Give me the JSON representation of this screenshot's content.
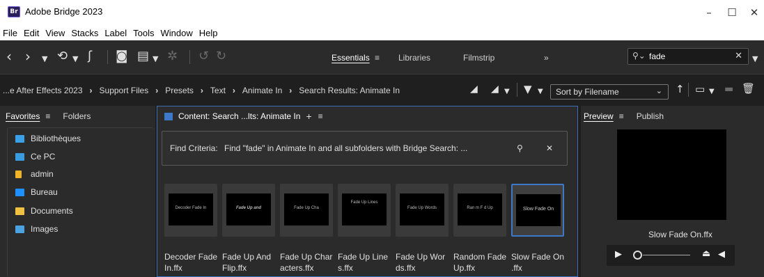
{
  "app": {
    "logo": "Br",
    "title": "Adobe Bridge 2023"
  },
  "window_controls": {
    "minimize": "–",
    "maximize": "☐",
    "close": "✕"
  },
  "menu": [
    "File",
    "Edit",
    "View",
    "Stacks",
    "Label",
    "Tools",
    "Window",
    "Help"
  ],
  "workspace": {
    "tabs": [
      "Essentials",
      "Libraries",
      "Filmstrip"
    ],
    "active": "Essentials",
    "menu_glyph": "≡",
    "more_glyph": "»"
  },
  "search": {
    "value": "fade",
    "placeholder": ""
  },
  "breadcrumb": [
    "...e After Effects 2023",
    "Support Files",
    "Presets",
    "Text",
    "Animate In",
    "Search Results: Animate In"
  ],
  "sort": {
    "label": "Sort by Filename"
  },
  "left_panel": {
    "tabs": [
      "Favorites",
      "Folders"
    ],
    "active": "Favorites",
    "items": [
      {
        "label": "Bibliothèques",
        "icon": "libraries-icon",
        "color": "#3aa0e8"
      },
      {
        "label": "Ce PC",
        "icon": "computer-icon",
        "color": "#3a9be0"
      },
      {
        "label": "admin",
        "icon": "user-folder-icon",
        "color": "#f0b429"
      },
      {
        "label": "Bureau",
        "icon": "desktop-icon",
        "color": "#1e90ff"
      },
      {
        "label": "Documents",
        "icon": "documents-icon",
        "color": "#f0c040"
      },
      {
        "label": "Images",
        "icon": "images-icon",
        "color": "#4aa3e0"
      }
    ]
  },
  "content": {
    "title": "Content: Search ...lts: Animate In",
    "add_glyph": "+",
    "menu_glyph": "≡",
    "criteria_label": "Find Criteria:",
    "criteria_text": "Find \"fade\" in Animate In and all subfolders with Bridge Search: ...",
    "files": [
      {
        "name": "Decoder Fade In.ffx",
        "caption": "Decoder Fade\nIn.ffx",
        "thumb_text": "Decoder Fade In",
        "selected": false
      },
      {
        "name": "Fade Up And Flip.ffx",
        "caption": "Fade Up And\nFlip.ffx",
        "thumb_text": "Fade Up and",
        "selected": false
      },
      {
        "name": "Fade Up Characters.ffx",
        "caption": "Fade Up Char\nacters.ffx",
        "thumb_text": "Fade Up Cha",
        "selected": false
      },
      {
        "name": "Fade Up Lines.ffx",
        "caption": "Fade Up Line\ns.ffx",
        "thumb_text": "Fade Up Lines",
        "selected": false
      },
      {
        "name": "Fade Up Words.ffx",
        "caption": "Fade Up Wor\nds.ffx",
        "thumb_text": "Fade Up Words",
        "selected": false
      },
      {
        "name": "Random Fade Up.ffx",
        "caption": "Random Fade\nUp.ffx",
        "thumb_text": "Ran  m F d  Up",
        "selected": false
      },
      {
        "name": "Slow Fade On.ffx",
        "caption": "Slow Fade On\n.ffx",
        "thumb_text": "Slow Fade On",
        "selected": true
      }
    ]
  },
  "right_panel": {
    "tabs": [
      "Preview",
      "Publish"
    ],
    "active": "Preview",
    "file_name": "Slow Fade On.ffx"
  },
  "colors": {
    "accent": "#3d78c9",
    "panel": "#2b2b2b",
    "background": "#1e1e1e"
  }
}
